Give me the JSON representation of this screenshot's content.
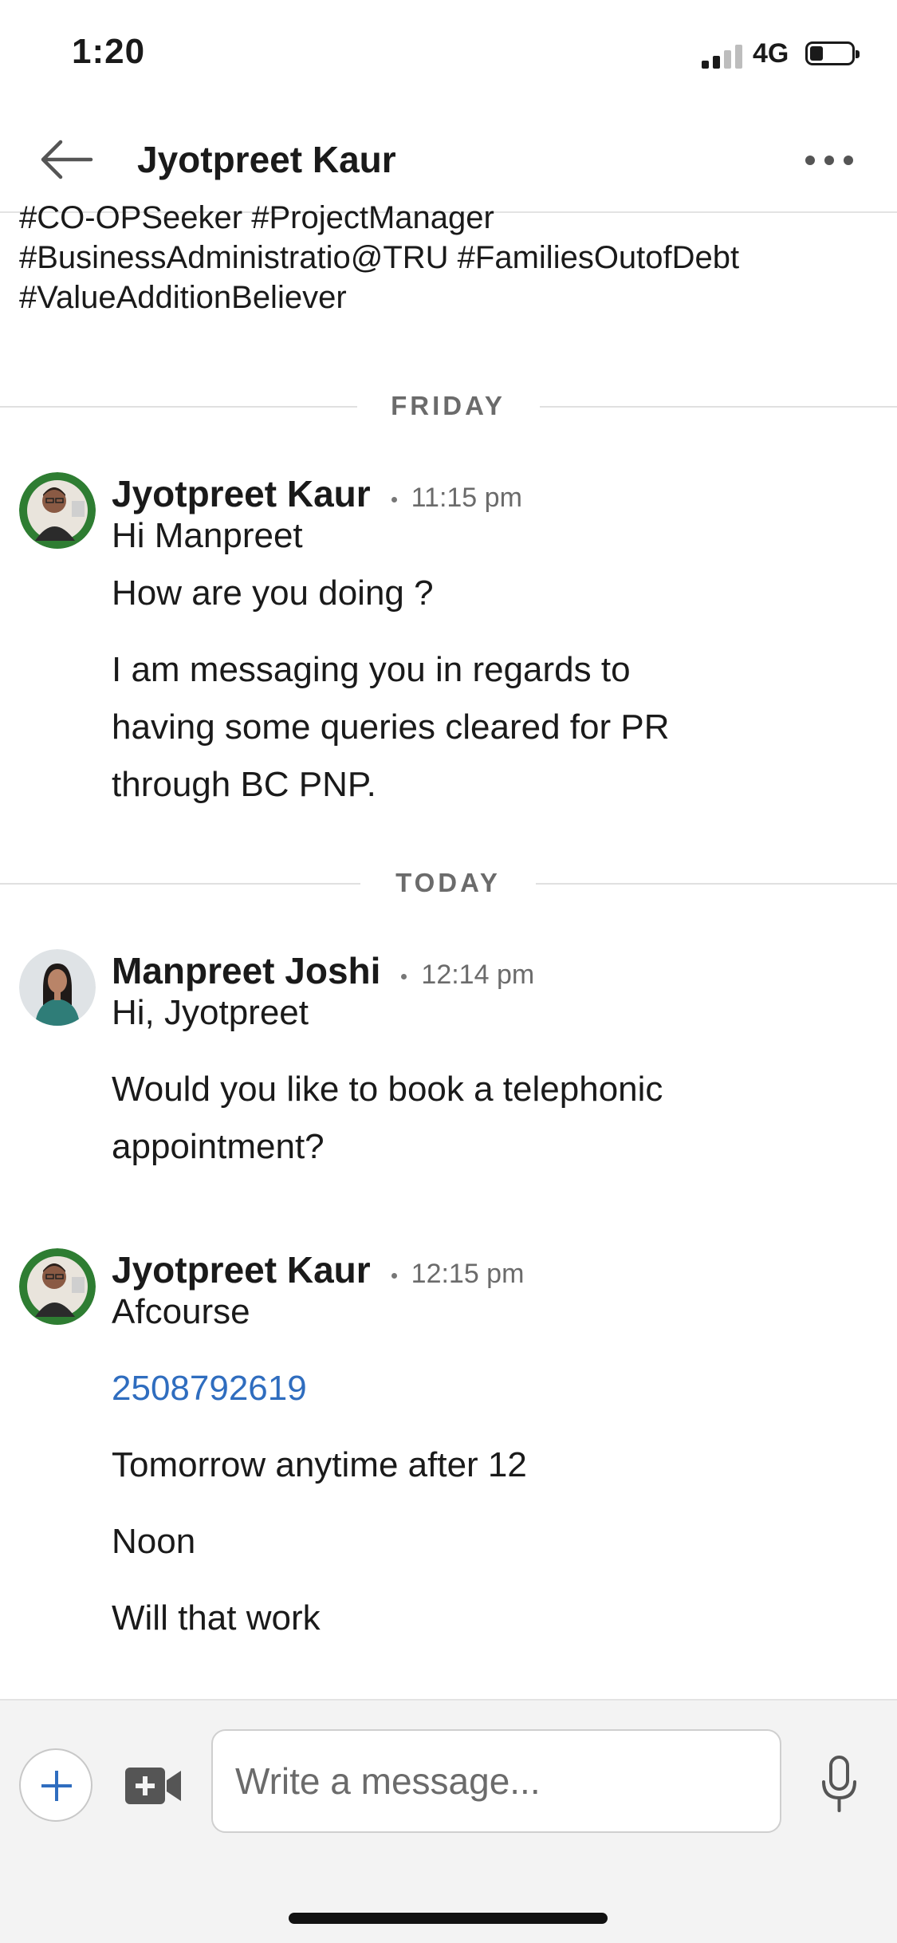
{
  "status_bar": {
    "time": "1:20",
    "network": "4G",
    "signal_bars_active": 2,
    "signal_bars_total": 4,
    "battery_level": 0.3
  },
  "header": {
    "title": "Jyotpreet Kaur",
    "back_icon": "arrow-left-icon",
    "more_icon": "more-horizontal-icon"
  },
  "profile": {
    "headline_lines": [
      "#CO-OPSeeker #ProjectManager",
      "#BusinessAdministratio@TRU #FamiliesOutofDebt",
      "#ValueAdditionBeliever"
    ]
  },
  "dividers": {
    "friday": "FRIDAY",
    "today": "TODAY"
  },
  "messages": [
    {
      "sender": "Jyotpreet Kaur",
      "time": "11:15 pm",
      "lines": [
        "Hi Manpreet",
        "How are you doing ?",
        "I am messaging you in regards to",
        "having some queries cleared for PR",
        "through BC PNP."
      ]
    },
    {
      "sender": "Manpreet Joshi",
      "time": "12:14 pm",
      "lines": [
        "Hi, Jyotpreet",
        "Would you like to book a telephonic",
        "appointment?"
      ]
    },
    {
      "sender": "Jyotpreet Kaur",
      "time": "12:15 pm",
      "lines": [
        "Afcourse",
        "2508792619",
        "Tomorrow anytime after 12",
        "Noon",
        "Will that work"
      ]
    }
  ],
  "composer": {
    "placeholder": "Write a message...",
    "value": "",
    "add_icon": "plus-icon",
    "video_icon": "video-camera-icon",
    "mic_icon": "microphone-icon"
  },
  "colors": {
    "link": "#2f6dbf",
    "avatar_ring": "#2e7d32"
  }
}
